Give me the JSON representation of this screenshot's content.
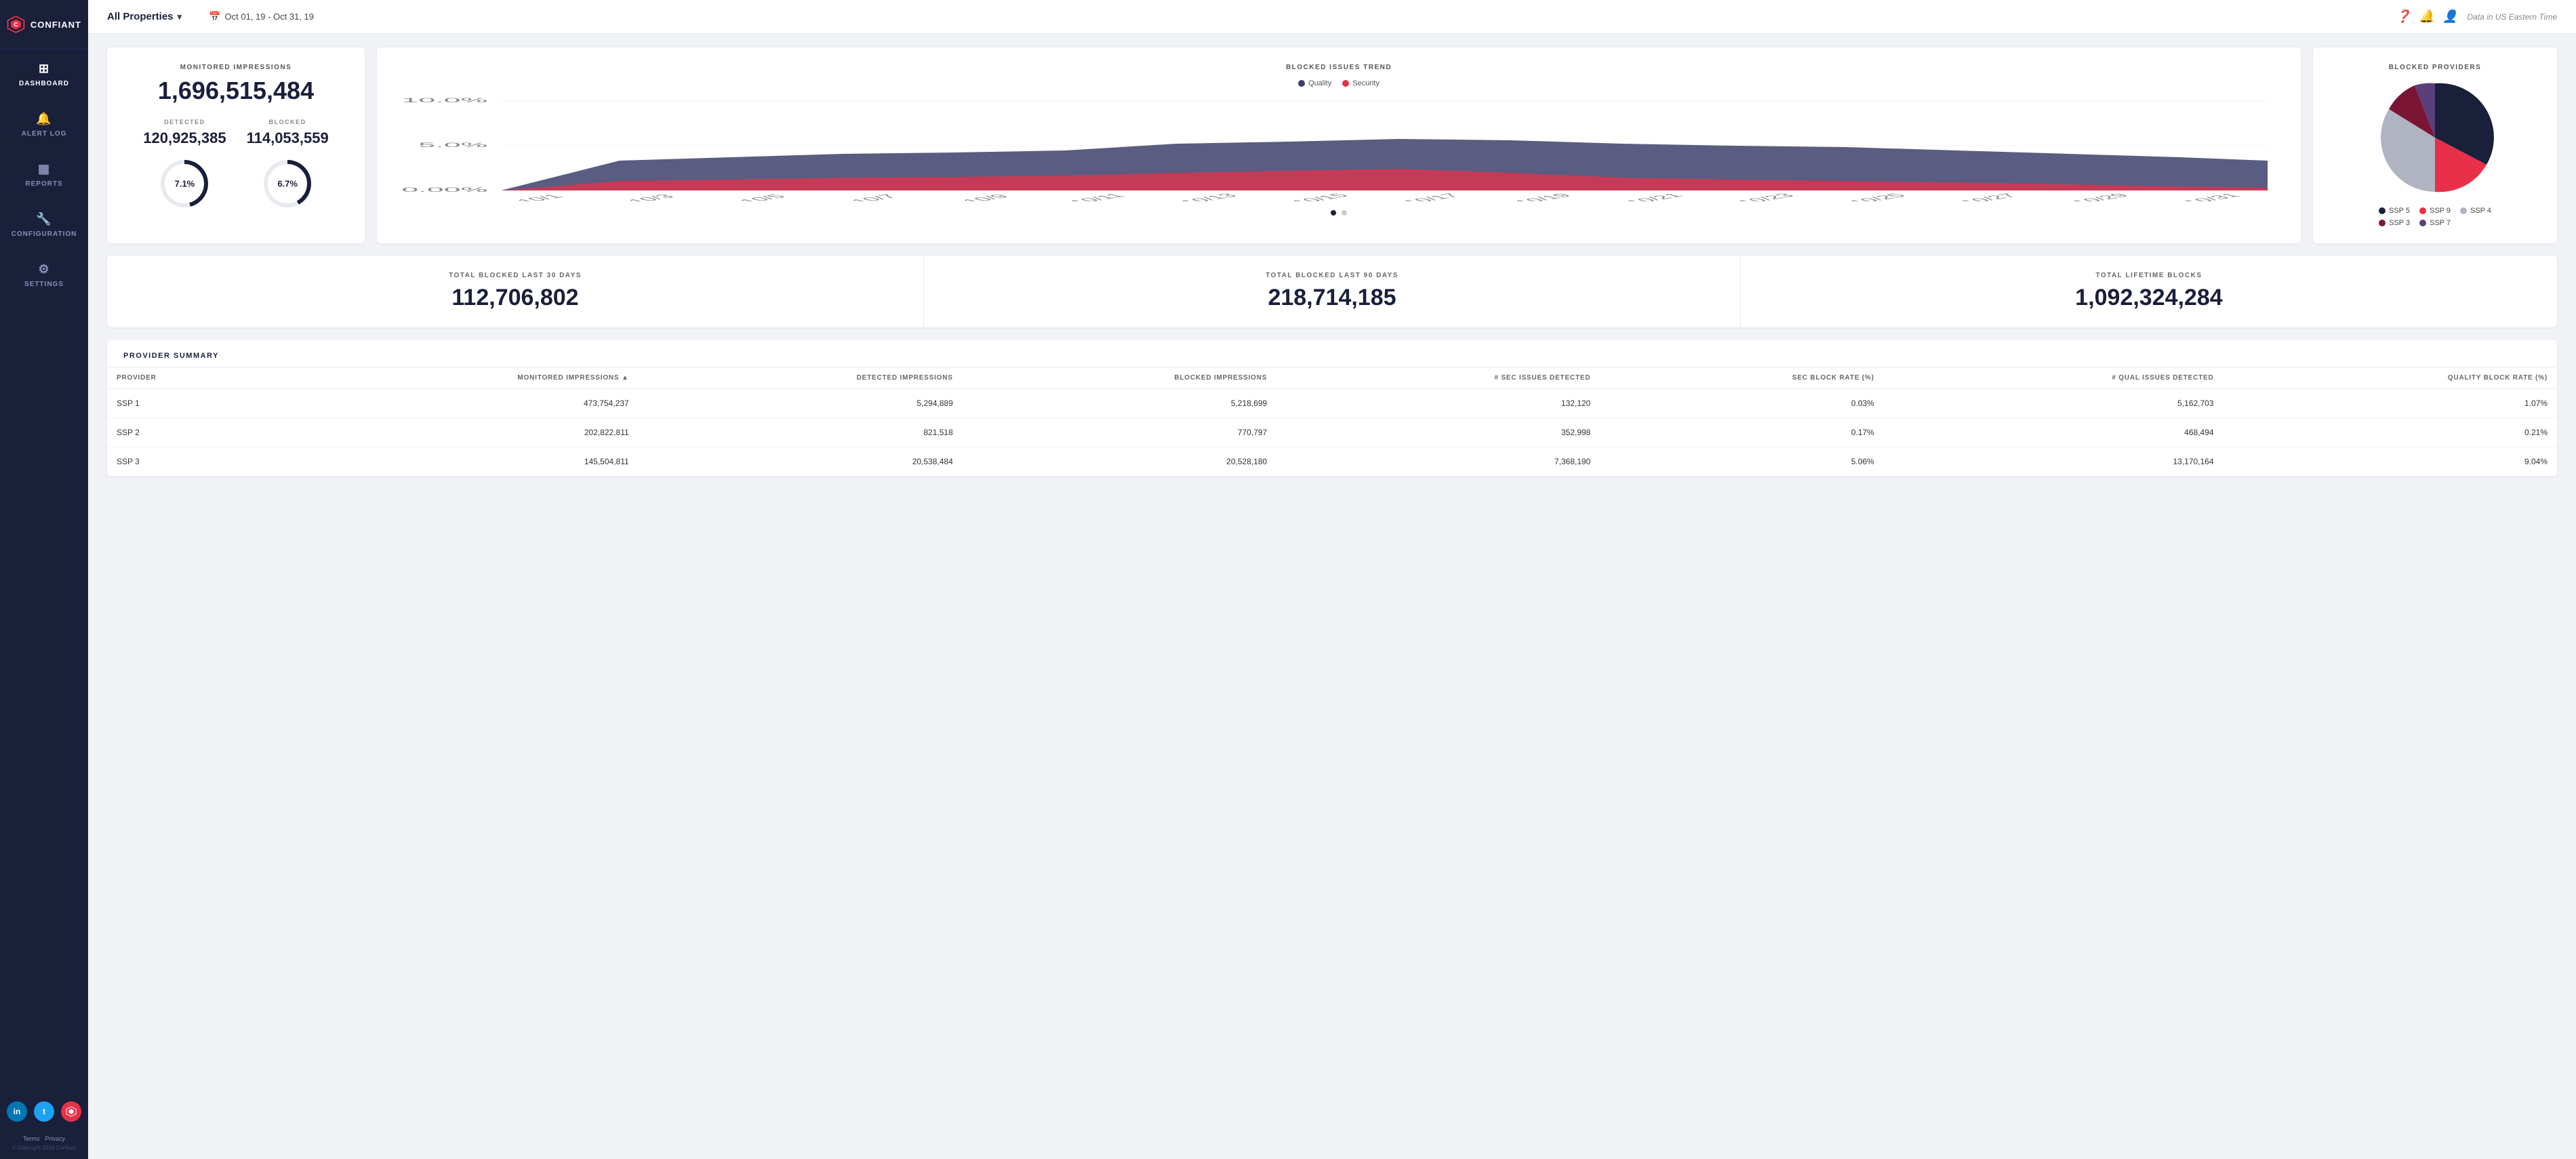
{
  "sidebar": {
    "logo_text": "CONFIANT",
    "nav_items": [
      {
        "id": "dashboard",
        "label": "DASHBOARD",
        "icon": "⊞",
        "active": true
      },
      {
        "id": "alert-log",
        "label": "ALERT LOG",
        "icon": "🔔",
        "active": false
      },
      {
        "id": "reports",
        "label": "REPORTS",
        "icon": "⊟",
        "active": false
      },
      {
        "id": "configuration",
        "label": "CONFIGURATION",
        "icon": "🔧",
        "active": false
      },
      {
        "id": "settings",
        "label": "SETTINGS",
        "icon": "⚙",
        "active": false
      }
    ],
    "terms_label": "Terms",
    "privacy_label": "Privacy",
    "copyright": "© Copyright 2019 Confiant"
  },
  "topbar": {
    "properties_label": "All Properties",
    "date_range": "Oct 01, 19 - Oct 31, 19",
    "timezone_note": "Data in US Eastern Time"
  },
  "monitored": {
    "title": "MONITORED IMPRESSIONS",
    "total": "1,696,515,484",
    "detected_label": "DETECTED",
    "detected_value": "120,925,385",
    "detected_pct": "7.1%",
    "blocked_label": "BLOCKED",
    "blocked_value": "114,053,559",
    "blocked_pct": "6.7%"
  },
  "trend": {
    "title": "BLOCKED ISSUES TREND",
    "legend": [
      {
        "label": "Quality",
        "color": "#3d3f6b"
      },
      {
        "label": "Security",
        "color": "#e8304a"
      }
    ],
    "y_labels": [
      "10.0%",
      "5.0%",
      "0.00%"
    ],
    "x_labels": [
      "10/1",
      "10/3",
      "10/5",
      "10/7",
      "10/9",
      "10/11",
      "10/13",
      "10/15",
      "10/17",
      "10/19",
      "10/21",
      "10/23",
      "10/25",
      "10/27",
      "10/29",
      "10/31"
    ]
  },
  "providers": {
    "title": "BLOCKED PROVIDERS",
    "legend": [
      {
        "label": "SSP 5",
        "color": "#1a1f3a"
      },
      {
        "label": "SSP 9",
        "color": "#e8304a"
      },
      {
        "label": "SSP 4",
        "color": "#b0b4c0"
      },
      {
        "label": "SSP 3",
        "color": "#8b1a3a"
      },
      {
        "label": "SSP 7",
        "color": "#5a3f7a"
      }
    ]
  },
  "summary": [
    {
      "label": "TOTAL BLOCKED LAST 30 DAYS",
      "value": "112,706,802"
    },
    {
      "label": "TOTAL BLOCKED LAST 90 DAYS",
      "value": "218,714,185"
    },
    {
      "label": "TOTAL LIFETIME BLOCKS",
      "value": "1,092,324,284"
    }
  ],
  "provider_table": {
    "title": "PROVIDER SUMMARY",
    "columns": [
      "Provider",
      "Monitored Impressions ▲",
      "Detected Impressions",
      "Blocked Impressions",
      "# Sec Issues Detected",
      "Sec Block Rate (%)",
      "# Qual Issues Detected",
      "Quality Block Rate (%)"
    ],
    "rows": [
      {
        "provider": "SSP 1",
        "monitored": "473,754,237",
        "detected": "5,294,889",
        "blocked": "5,218,699",
        "sec_detected": "132,120",
        "sec_rate": "0.03%",
        "qual_detected": "5,162,703",
        "qual_rate": "1.07%"
      },
      {
        "provider": "SSP 2",
        "monitored": "202,822,811",
        "detected": "821,518",
        "blocked": "770,797",
        "sec_detected": "352,998",
        "sec_rate": "0.17%",
        "qual_detected": "468,494",
        "qual_rate": "0.21%"
      },
      {
        "provider": "SSP 3",
        "monitored": "145,504,811",
        "detected": "20,538,484",
        "blocked": "20,528,180",
        "sec_detected": "7,368,190",
        "sec_rate": "5.06%",
        "qual_detected": "13,170,164",
        "qual_rate": "9.04%"
      }
    ]
  },
  "colors": {
    "sidebar_bg": "#1a1f3a",
    "quality_area": "#3d3f6b",
    "security_area": "#e8304a",
    "accent": "#e8304a"
  }
}
